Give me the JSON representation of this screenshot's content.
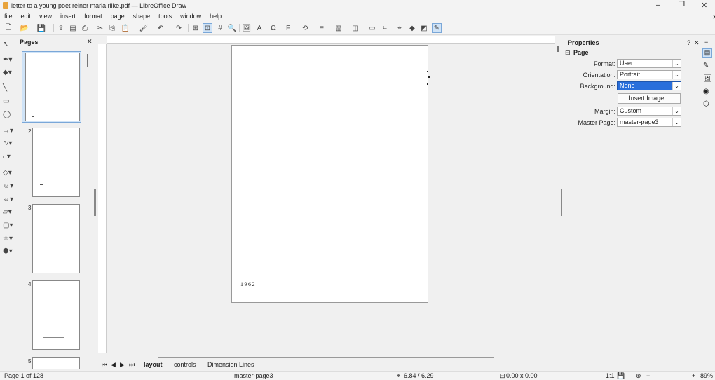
{
  "window": {
    "title": "letter to a young poet reiner maria rilke.pdf — LibreOffice Draw"
  },
  "menu": [
    "file",
    "edit",
    "view",
    "insert",
    "format",
    "page",
    "shape",
    "tools",
    "window",
    "help"
  ],
  "pages_panel": {
    "title": "Pages",
    "thumbs": [
      "1",
      "2",
      "3",
      "4",
      "5"
    ]
  },
  "page_content": {
    "year": "1962"
  },
  "tabs": [
    "layout",
    "controls",
    "Dimension Lines"
  ],
  "properties": {
    "title": "Properties",
    "section": "Page",
    "format_label": "Format:",
    "format_value": "User",
    "orientation_label": "Orientation:",
    "orientation_value": "Portrait",
    "background_label": "Background:",
    "background_value": "None",
    "insert_image": "Insert Image...",
    "margin_label": "Margin:",
    "margin_value": "Custom",
    "master_label": "Master Page:",
    "master_value": "master-page3"
  },
  "status": {
    "page": "Page 1 of 128",
    "master": "master-page3",
    "position": "6.84 / 6.29",
    "size": "0.00 x 0.00",
    "ratio": "1:1",
    "zoom": "89%"
  },
  "colors": {
    "accent": "#2a6fdb",
    "selection": "#cfe3f7"
  }
}
